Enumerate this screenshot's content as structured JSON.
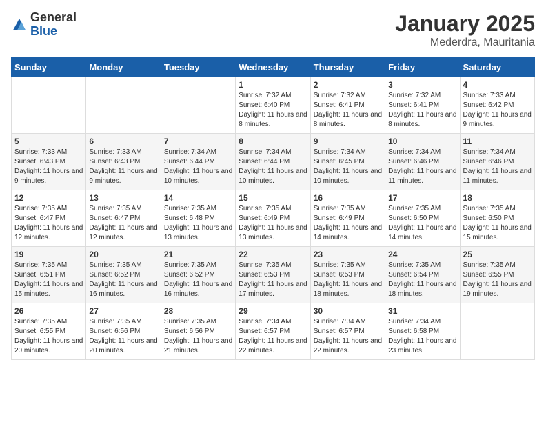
{
  "header": {
    "logo_general": "General",
    "logo_blue": "Blue",
    "month": "January 2025",
    "location": "Mederdra, Mauritania"
  },
  "days_of_week": [
    "Sunday",
    "Monday",
    "Tuesday",
    "Wednesday",
    "Thursday",
    "Friday",
    "Saturday"
  ],
  "weeks": [
    [
      {
        "day": "",
        "info": ""
      },
      {
        "day": "",
        "info": ""
      },
      {
        "day": "",
        "info": ""
      },
      {
        "day": "1",
        "info": "Sunrise: 7:32 AM\nSunset: 6:40 PM\nDaylight: 11 hours and 8 minutes."
      },
      {
        "day": "2",
        "info": "Sunrise: 7:32 AM\nSunset: 6:41 PM\nDaylight: 11 hours and 8 minutes."
      },
      {
        "day": "3",
        "info": "Sunrise: 7:32 AM\nSunset: 6:41 PM\nDaylight: 11 hours and 8 minutes."
      },
      {
        "day": "4",
        "info": "Sunrise: 7:33 AM\nSunset: 6:42 PM\nDaylight: 11 hours and 9 minutes."
      }
    ],
    [
      {
        "day": "5",
        "info": "Sunrise: 7:33 AM\nSunset: 6:43 PM\nDaylight: 11 hours and 9 minutes."
      },
      {
        "day": "6",
        "info": "Sunrise: 7:33 AM\nSunset: 6:43 PM\nDaylight: 11 hours and 9 minutes."
      },
      {
        "day": "7",
        "info": "Sunrise: 7:34 AM\nSunset: 6:44 PM\nDaylight: 11 hours and 10 minutes."
      },
      {
        "day": "8",
        "info": "Sunrise: 7:34 AM\nSunset: 6:44 PM\nDaylight: 11 hours and 10 minutes."
      },
      {
        "day": "9",
        "info": "Sunrise: 7:34 AM\nSunset: 6:45 PM\nDaylight: 11 hours and 10 minutes."
      },
      {
        "day": "10",
        "info": "Sunrise: 7:34 AM\nSunset: 6:46 PM\nDaylight: 11 hours and 11 minutes."
      },
      {
        "day": "11",
        "info": "Sunrise: 7:34 AM\nSunset: 6:46 PM\nDaylight: 11 hours and 11 minutes."
      }
    ],
    [
      {
        "day": "12",
        "info": "Sunrise: 7:35 AM\nSunset: 6:47 PM\nDaylight: 11 hours and 12 minutes."
      },
      {
        "day": "13",
        "info": "Sunrise: 7:35 AM\nSunset: 6:47 PM\nDaylight: 11 hours and 12 minutes."
      },
      {
        "day": "14",
        "info": "Sunrise: 7:35 AM\nSunset: 6:48 PM\nDaylight: 11 hours and 13 minutes."
      },
      {
        "day": "15",
        "info": "Sunrise: 7:35 AM\nSunset: 6:49 PM\nDaylight: 11 hours and 13 minutes."
      },
      {
        "day": "16",
        "info": "Sunrise: 7:35 AM\nSunset: 6:49 PM\nDaylight: 11 hours and 14 minutes."
      },
      {
        "day": "17",
        "info": "Sunrise: 7:35 AM\nSunset: 6:50 PM\nDaylight: 11 hours and 14 minutes."
      },
      {
        "day": "18",
        "info": "Sunrise: 7:35 AM\nSunset: 6:50 PM\nDaylight: 11 hours and 15 minutes."
      }
    ],
    [
      {
        "day": "19",
        "info": "Sunrise: 7:35 AM\nSunset: 6:51 PM\nDaylight: 11 hours and 15 minutes."
      },
      {
        "day": "20",
        "info": "Sunrise: 7:35 AM\nSunset: 6:52 PM\nDaylight: 11 hours and 16 minutes."
      },
      {
        "day": "21",
        "info": "Sunrise: 7:35 AM\nSunset: 6:52 PM\nDaylight: 11 hours and 16 minutes."
      },
      {
        "day": "22",
        "info": "Sunrise: 7:35 AM\nSunset: 6:53 PM\nDaylight: 11 hours and 17 minutes."
      },
      {
        "day": "23",
        "info": "Sunrise: 7:35 AM\nSunset: 6:53 PM\nDaylight: 11 hours and 18 minutes."
      },
      {
        "day": "24",
        "info": "Sunrise: 7:35 AM\nSunset: 6:54 PM\nDaylight: 11 hours and 18 minutes."
      },
      {
        "day": "25",
        "info": "Sunrise: 7:35 AM\nSunset: 6:55 PM\nDaylight: 11 hours and 19 minutes."
      }
    ],
    [
      {
        "day": "26",
        "info": "Sunrise: 7:35 AM\nSunset: 6:55 PM\nDaylight: 11 hours and 20 minutes."
      },
      {
        "day": "27",
        "info": "Sunrise: 7:35 AM\nSunset: 6:56 PM\nDaylight: 11 hours and 20 minutes."
      },
      {
        "day": "28",
        "info": "Sunrise: 7:35 AM\nSunset: 6:56 PM\nDaylight: 11 hours and 21 minutes."
      },
      {
        "day": "29",
        "info": "Sunrise: 7:34 AM\nSunset: 6:57 PM\nDaylight: 11 hours and 22 minutes."
      },
      {
        "day": "30",
        "info": "Sunrise: 7:34 AM\nSunset: 6:57 PM\nDaylight: 11 hours and 22 minutes."
      },
      {
        "day": "31",
        "info": "Sunrise: 7:34 AM\nSunset: 6:58 PM\nDaylight: 11 hours and 23 minutes."
      },
      {
        "day": "",
        "info": ""
      }
    ]
  ]
}
